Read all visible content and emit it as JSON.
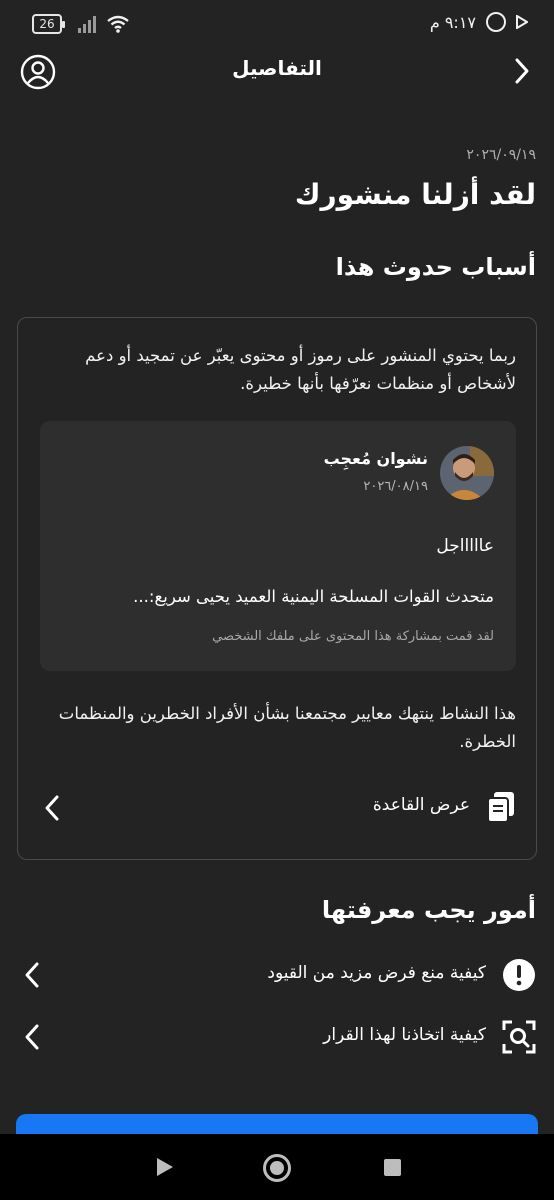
{
  "status_bar": {
    "time": "٩:١٧ م",
    "battery": "26"
  },
  "header": {
    "title": "التفاصيل"
  },
  "notice": {
    "date": "٢٠٢٦/٠٩/١٩",
    "headline": "لقد أزلنا منشورك",
    "reasons_title": "أسباب حدوث هذا"
  },
  "card": {
    "description": "ربما يحتوي المنشور على رموز أو محتوى يعبّر عن تمجيد أو دعم لأشخاص أو منظمات نعرّفها بأنها خطيرة.",
    "post": {
      "author": "نشوان مُعجِب",
      "date": "٢٠٢٦/٠٨/١٩",
      "text_line1": "عاااااجل",
      "text_line2": "متحدث القوات المسلحة اليمنية العميد يحيى سريع:...",
      "share_note": "لقد قمت بمشاركة هذا المحتوى على ملفك الشخصي"
    },
    "violation_text": "هذا النشاط ينتهك معايير مجتمعنا بشأن الأفراد الخطرين والمنظمات الخطرة.",
    "rule_label": "عرض القاعدة"
  },
  "know": {
    "title": "أمور يجب معرفتها",
    "items": [
      {
        "label": "كيفية منع فرض مزيد من القيود",
        "icon": "exclamation-icon"
      },
      {
        "label": "كيفية اتخاذنا لهذا القرار",
        "icon": "scan-search-icon"
      }
    ]
  },
  "colors": {
    "background": "#232323",
    "card_border": "#4a4a4a",
    "post_background": "#2e2e2e",
    "primary_button": "#1877f2"
  }
}
